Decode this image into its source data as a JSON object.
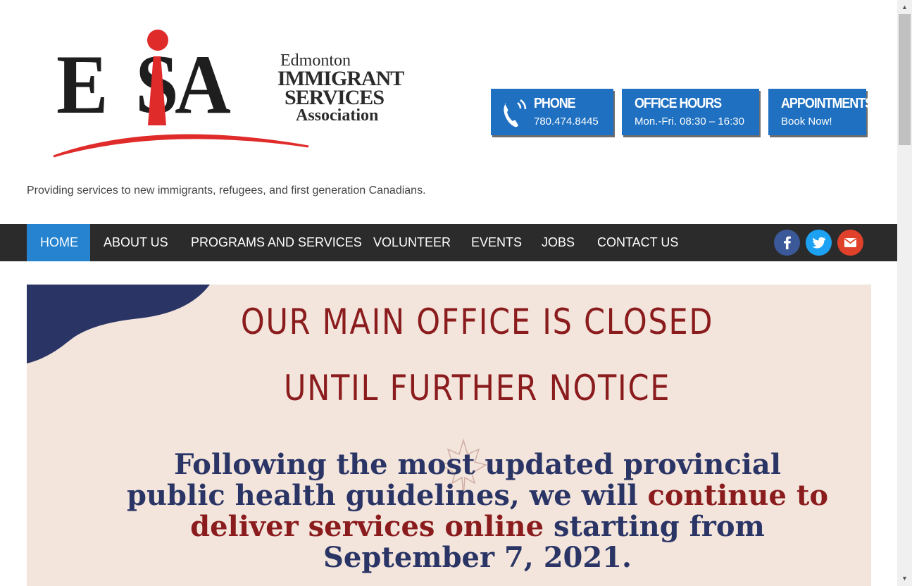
{
  "logo": {
    "mark": "E SA",
    "sub1": "Edmonton",
    "sub2": "IMMIGRANT",
    "sub3": "SERVICES",
    "sub4": "Association"
  },
  "tagline": "Providing services to new immigrants, refugees, and first generation Canadians.",
  "info": {
    "phone_title": "PHONE",
    "phone_value": "780.474.8445",
    "hours_title": "OFFICE HOURS",
    "hours_value": "Mon.-Fri. 08:30 – 16:30",
    "appt_title": "APPOINTMENTS",
    "appt_value": "Book Now!"
  },
  "nav": {
    "items": [
      "HOME",
      "ABOUT US",
      "PROGRAMS AND SERVICES",
      "VOLUNTEER",
      "EVENTS",
      "JOBS",
      "CONTACT US"
    ],
    "active": "HOME"
  },
  "social": [
    {
      "icon": "facebook-icon",
      "color": "#3b5998"
    },
    {
      "icon": "twitter-icon",
      "color": "#1da1f2"
    },
    {
      "icon": "email-icon",
      "color": "#e0412b"
    }
  ],
  "banner": {
    "line1": "OUR MAIN OFFICE IS CLOSED",
    "line2": "UNTIL FURTHER NOTICE",
    "body_a": "Following the most updated provincial public health guidelines, we will ",
    "body_red": "continue to deliver services online",
    "body_b": " starting from September 7, 2021."
  },
  "colors": {
    "brand_blue": "#1f70c1",
    "nav_bg": "#2b2b2b",
    "nav_active": "#2583d0",
    "logo_red": "#e02b2b",
    "banner_bg": "#f3e5dc",
    "banner_red": "#8b1c1e",
    "banner_navy": "#2a3566"
  }
}
